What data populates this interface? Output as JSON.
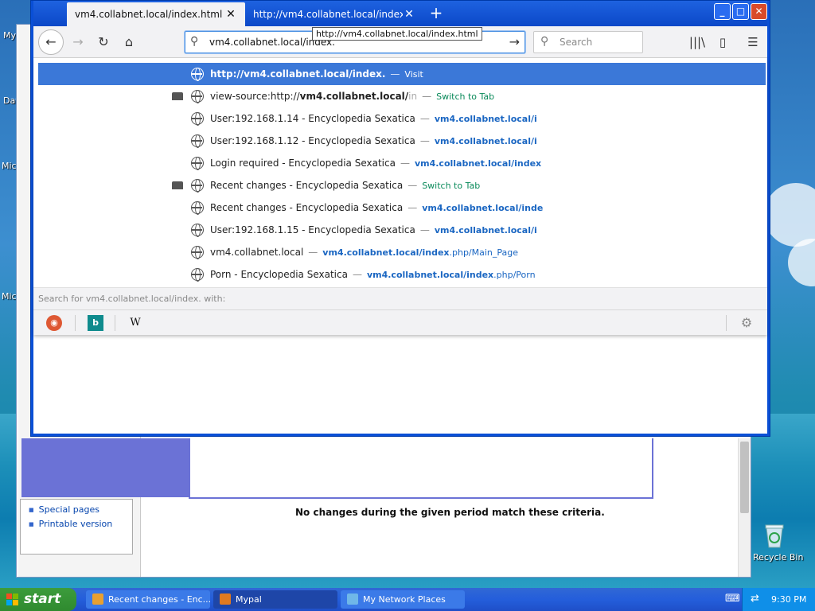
{
  "desktop": {
    "icon_labels": [
      "My",
      "Dat",
      "Mic",
      "Mic"
    ],
    "recycle_bin_label": "Recycle Bin"
  },
  "background_page": {
    "toolbox_links": [
      "Special pages",
      "Printable version"
    ],
    "message": "No changes during the given period match these criteria."
  },
  "browser": {
    "tabs": [
      {
        "label": "vm4.collabnet.local/index.html",
        "active": true
      },
      {
        "label": "http://vm4.collabnet.local/index.html",
        "active": false
      }
    ],
    "window_buttons": {
      "minimize": "_",
      "maximize": "□",
      "close": "✕"
    },
    "url_value": "vm4.collabnet.local/index.",
    "url_tooltip": "http://vm4.collabnet.local/index.html",
    "search_placeholder": "Search",
    "toolbar_icons": [
      "library-icon",
      "sidebar-icon",
      "menu-icon"
    ]
  },
  "dropdown": {
    "rows": [
      {
        "has_tab_icon": false,
        "title": "http://vm4.collabnet.local/index.",
        "title_bold": true,
        "action": "Visit",
        "url": "",
        "selected": true
      },
      {
        "has_tab_icon": true,
        "title_prefix": "view-source:http://",
        "title_bold_part": "vm4.collabnet.local/",
        "title_suffix": "in",
        "action": "Switch to Tab",
        "url": "",
        "selected": false
      },
      {
        "has_tab_icon": false,
        "title": "User:192.168.1.14 - Encyclopedia Sexatica",
        "action": "",
        "url_bold": "vm4.collabnet.local/i",
        "url_rest": "",
        "selected": false
      },
      {
        "has_tab_icon": false,
        "title": "User:192.168.1.12 - Encyclopedia Sexatica",
        "action": "",
        "url_bold": "vm4.collabnet.local/i",
        "url_rest": "",
        "selected": false
      },
      {
        "has_tab_icon": false,
        "title": "Login required - Encyclopedia Sexatica",
        "action": "",
        "url_bold": "vm4.collabnet.local/index",
        "url_rest": "",
        "selected": false
      },
      {
        "has_tab_icon": true,
        "title": "Recent changes - Encyclopedia Sexatica",
        "action": "Switch to Tab",
        "url": "",
        "selected": false
      },
      {
        "has_tab_icon": false,
        "title": "Recent changes - Encyclopedia Sexatica",
        "action": "",
        "url_bold": "vm4.collabnet.local/inde",
        "url_rest": "",
        "selected": false
      },
      {
        "has_tab_icon": false,
        "title": "User:192.168.1.15 - Encyclopedia Sexatica",
        "action": "",
        "url_bold": "vm4.collabnet.local/i",
        "url_rest": "",
        "selected": false
      },
      {
        "has_tab_icon": false,
        "title": "vm4.collabnet.local",
        "action": "",
        "url_bold": "vm4.collabnet.local/index",
        "url_rest": ".php/Main_Page",
        "selected": false
      },
      {
        "has_tab_icon": false,
        "title": "Porn - Encyclopedia Sexatica",
        "action": "",
        "url_bold": "vm4.collabnet.local/index",
        "url_rest": ".php/Porn",
        "selected": false
      }
    ],
    "search_with_prefix": "Search for ",
    "search_with_query": "vm4.collabnet.local/index.",
    "search_with_suffix": " with:",
    "engines": [
      "duckduckgo-icon",
      "bing-icon",
      "wikipedia-icon"
    ],
    "wiki_glyph": "W",
    "bing_glyph": "b"
  },
  "taskbar": {
    "start_label": "start",
    "tasks": [
      {
        "label": "Recent changes - Enc...",
        "active": false
      },
      {
        "label": "Mypal",
        "active": true
      },
      {
        "label": "My Network Places",
        "active": false
      }
    ],
    "clock": "9:30 PM"
  },
  "colors": {
    "selection": "#3b78d8",
    "switch_to_tab": "#0a8a5a",
    "url_link": "#1a66c2",
    "titlebar": "#0b48c8"
  }
}
